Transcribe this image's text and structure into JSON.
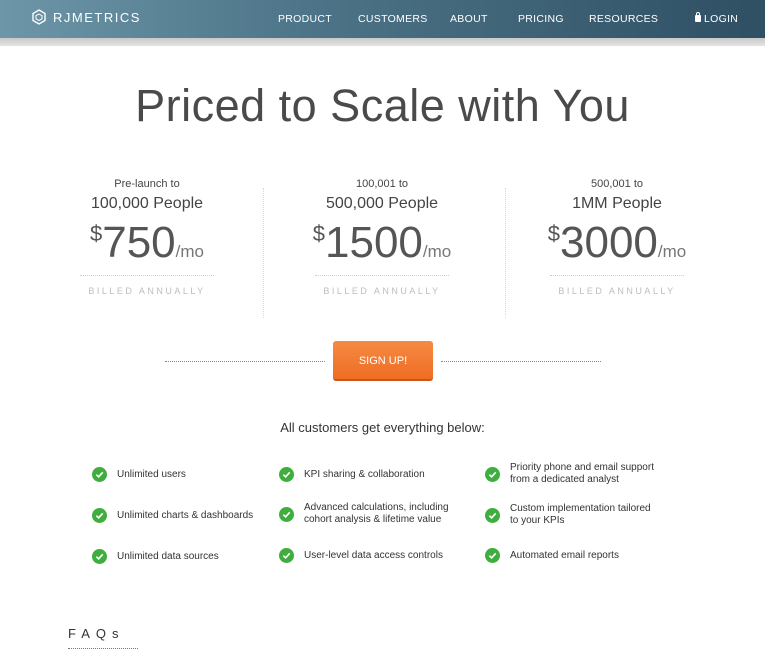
{
  "nav": {
    "brand": "RJMETRICS",
    "links": [
      "PRODUCT",
      "CUSTOMERS",
      "ABOUT",
      "PRICING",
      "RESOURCES"
    ],
    "login": "LOGIN"
  },
  "headline": "Priced to Scale with You",
  "tiers": [
    {
      "range_small": "Pre-launch to",
      "range_big": "100,000 People",
      "currency": "$",
      "amount": "750",
      "period": "/mo",
      "billing": "BILLED ANNUALLY"
    },
    {
      "range_small": "100,001 to",
      "range_big": "500,000 People",
      "currency": "$",
      "amount": "1500",
      "period": "/mo",
      "billing": "BILLED ANNUALLY"
    },
    {
      "range_small": "500,001 to",
      "range_big": "1MM People",
      "currency": "$",
      "amount": "3000",
      "period": "/mo",
      "billing": "BILLED ANNUALLY"
    }
  ],
  "signup_label": "SIGN UP!",
  "features_title": "All customers get everything below:",
  "features": [
    [
      "Unlimited users",
      "KPI sharing & collaboration",
      "Priority phone and email support from a dedicated analyst"
    ],
    [
      "Unlimited charts & dashboards",
      "Advanced calculations, including cohort analysis & lifetime value",
      "Custom implementation tailored to your KPIs"
    ],
    [
      "Unlimited data sources",
      "User-level data access controls",
      "Automated email reports"
    ]
  ],
  "faq_title": "FAQs",
  "colors": {
    "accent": "#ef6d22",
    "check": "#3fae3f",
    "nav_dark": "#2f4f63"
  }
}
